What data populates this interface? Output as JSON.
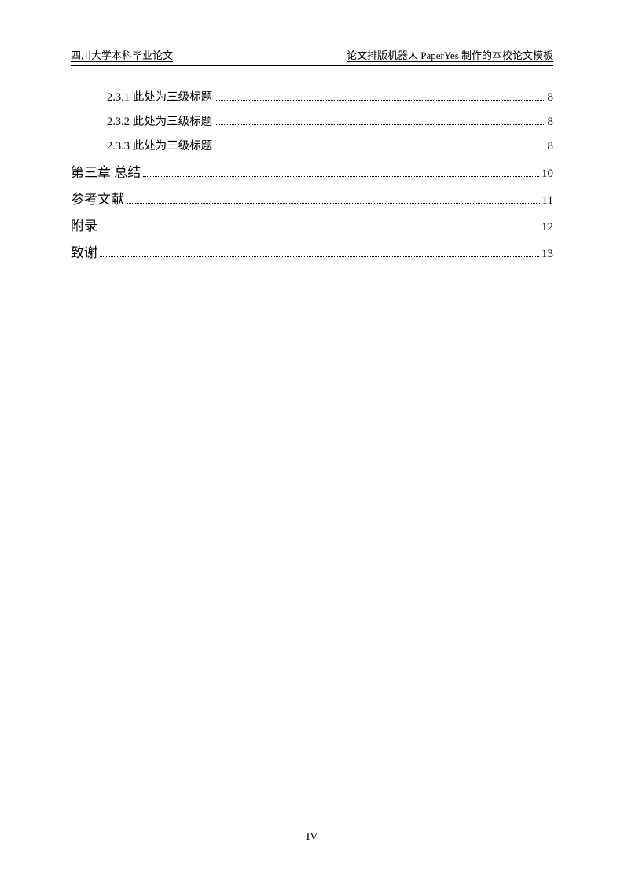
{
  "header": {
    "left": "四川大学本科毕业论文",
    "right": "论文排版机器人 PaperYes 制作的本校论文模板"
  },
  "toc": {
    "entries": [
      {
        "label": "2.3.1 此处为三级标题",
        "page": "8",
        "level": "indent"
      },
      {
        "label": "2.3.2 此处为三级标题",
        "page": "8",
        "level": "indent"
      },
      {
        "label": "2.3.3 此处为三级标题",
        "page": "8",
        "level": "indent"
      },
      {
        "label": "第三章 总结",
        "page": "10",
        "level": "chapter"
      },
      {
        "label": "参考文献",
        "page": "11",
        "level": "chapter"
      },
      {
        "label": "附录",
        "page": "12",
        "level": "chapter"
      },
      {
        "label": "致谢",
        "page": "13",
        "level": "chapter"
      }
    ]
  },
  "footer": {
    "page_number": "IV"
  }
}
